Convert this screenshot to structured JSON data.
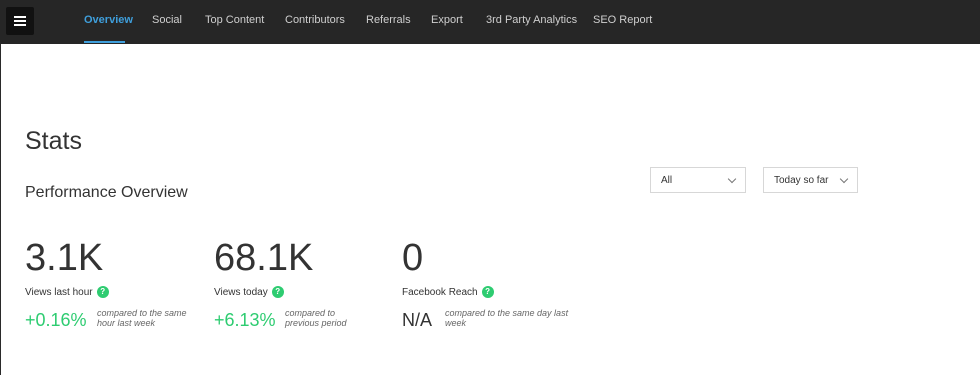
{
  "nav": {
    "items": [
      {
        "label": "Overview",
        "active": true
      },
      {
        "label": "Social",
        "active": false
      },
      {
        "label": "Top Content",
        "active": false
      },
      {
        "label": "Contributors",
        "active": false
      },
      {
        "label": "Referrals",
        "active": false
      },
      {
        "label": "Export",
        "active": false
      },
      {
        "label": "3rd Party Analytics",
        "active": false
      },
      {
        "label": "SEO Report",
        "active": false
      }
    ]
  },
  "page": {
    "title": "Stats",
    "section_title": "Performance Overview"
  },
  "filters": {
    "scope": "All",
    "period": "Today so far"
  },
  "stats": [
    {
      "value": "3.1K",
      "label": "Views last hour",
      "change": "+0.16%",
      "compare": "compared to the same hour last week"
    },
    {
      "value": "68.1K",
      "label": "Views today",
      "change": "+6.13%",
      "compare": "compared to previous period"
    },
    {
      "value": "0",
      "label": "Facebook Reach",
      "change": "N/A",
      "compare": "compared to the same day last week"
    }
  ],
  "colors": {
    "topbar": "#262626",
    "accent": "#3f9fdc",
    "positive": "#2ecc71"
  },
  "icons": {
    "menu": "hamburger-menu-icon",
    "help": "question-mark-icon",
    "dropdown": "chevron-down-icon"
  }
}
